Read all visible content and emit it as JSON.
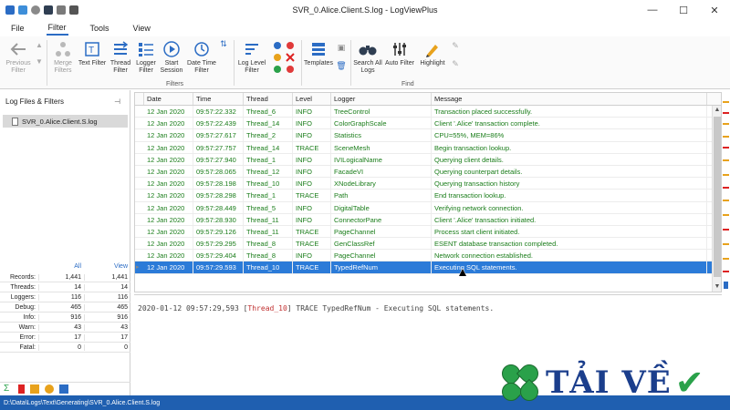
{
  "window": {
    "title": "SVR_0.Alice.Client.S.log - LogViewPlus"
  },
  "menu": {
    "tabs": [
      "File",
      "Filter",
      "Tools",
      "View"
    ],
    "active_tab": "Filter"
  },
  "ribbon": {
    "buttons": [
      {
        "label": "Previous Filter",
        "icon": "arrow-left-icon",
        "disabled": true
      },
      {
        "label": "Merge Filters",
        "icon": "merge-icon",
        "disabled": true
      },
      {
        "label": "Text Filter",
        "icon": "text-filter-icon",
        "disabled": false
      },
      {
        "label": "Thread Filter",
        "icon": "thread-filter-icon",
        "disabled": false
      },
      {
        "label": "Logger Filter",
        "icon": "logger-filter-icon",
        "disabled": false
      },
      {
        "label": "Start Session",
        "icon": "play-icon",
        "disabled": false
      },
      {
        "label": "Date Time Filter",
        "icon": "clock-icon",
        "disabled": false
      },
      {
        "label": "Log Level Filter",
        "icon": "log-level-icon",
        "disabled": false
      },
      {
        "label": "Templates",
        "icon": "templates-icon",
        "disabled": false
      },
      {
        "label": "Search All Logs",
        "icon": "binoculars-icon",
        "disabled": false
      },
      {
        "label": "Auto Filter",
        "icon": "sliders-icon",
        "disabled": false
      },
      {
        "label": "Highlight",
        "icon": "highlight-pen-icon",
        "disabled": false
      }
    ],
    "groups": {
      "filters": "Filters",
      "find": "Find"
    }
  },
  "left_pane": {
    "title": "Log Files & Filters",
    "file": "SVR_0.Alice.Client.S.log",
    "stats_headers": {
      "all": "All",
      "view": "View"
    },
    "stats": [
      {
        "label": "Records:",
        "all": "1,441",
        "view": "1,441"
      },
      {
        "label": "Threads:",
        "all": "14",
        "view": "14"
      },
      {
        "label": "Loggers:",
        "all": "116",
        "view": "116"
      },
      {
        "label": "Debug:",
        "all": "465",
        "view": "465"
      },
      {
        "label": "Info:",
        "all": "916",
        "view": "916"
      },
      {
        "label": "Warn:",
        "all": "43",
        "view": "43"
      },
      {
        "label": "Error:",
        "all": "17",
        "view": "17"
      },
      {
        "label": "Fatal:",
        "all": "0",
        "view": "0"
      }
    ]
  },
  "grid": {
    "headers": [
      "Date",
      "Time",
      "Thread",
      "Level",
      "Logger",
      "Message"
    ],
    "rows": [
      [
        "12 Jan 2020",
        "09:57:22.332",
        "Thread_6",
        "INFO",
        "TreeControl",
        "Transaction placed successfully."
      ],
      [
        "12 Jan 2020",
        "09:57:22.439",
        "Thread_14",
        "INFO",
        "ColorGraphScale",
        "Client '.Alice' transaction complete."
      ],
      [
        "12 Jan 2020",
        "09:57:27.617",
        "Thread_2",
        "INFO",
        "Statistics",
        "CPU=55%, MEM=86%"
      ],
      [
        "12 Jan 2020",
        "09:57:27.757",
        "Thread_14",
        "TRACE",
        "SceneMesh",
        "Begin transaction lookup."
      ],
      [
        "12 Jan 2020",
        "09:57:27.940",
        "Thread_1",
        "INFO",
        "IVILogicalName",
        "Querying client details."
      ],
      [
        "12 Jan 2020",
        "09:57:28.065",
        "Thread_12",
        "INFO",
        "FacadeVI",
        "Querying counterpart details."
      ],
      [
        "12 Jan 2020",
        "09:57:28.198",
        "Thread_10",
        "INFO",
        "XNodeLibrary",
        "Querying transaction history"
      ],
      [
        "12 Jan 2020",
        "09:57:28.298",
        "Thread_1",
        "TRACE",
        "Path",
        "End transaction lookup."
      ],
      [
        "12 Jan 2020",
        "09:57:28.449",
        "Thread_5",
        "INFO",
        "DigitalTable",
        "Verifying network connection."
      ],
      [
        "12 Jan 2020",
        "09:57:28.930",
        "Thread_11",
        "INFO",
        "ConnectorPane",
        "Client '.Alice' transaction initiated."
      ],
      [
        "12 Jan 2020",
        "09:57:29.126",
        "Thread_11",
        "TRACE",
        "PageChannel",
        "Process start client initiated."
      ],
      [
        "12 Jan 2020",
        "09:57:29.295",
        "Thread_8",
        "TRACE",
        "GenClassRef",
        "ESENT database transaction completed."
      ],
      [
        "12 Jan 2020",
        "09:57:29.404",
        "Thread_8",
        "INFO",
        "PageChannel",
        "Network connection established."
      ],
      [
        "12 Jan 2020",
        "09:57:29.593",
        "Thread_10",
        "TRACE",
        "TypedRefNum",
        "Executing SQL statements."
      ]
    ],
    "selected_index": 13
  },
  "detail": {
    "prefix": "2020-01-12 09:57:29,593 [",
    "thread": "Thread_10",
    "suffix": "] TRACE TypedRefNum - Executing SQL statements."
  },
  "statusbar": {
    "path": "D:\\Data\\Logs\\Text\\Generating\\SVR_0.Alice.Client.S.log"
  },
  "watermark": {
    "text": "TẢI VỀ"
  },
  "colors": {
    "accent": "#2b7bd8",
    "statusbar": "#1f5fb0",
    "row_text": "#1a7d1a"
  }
}
